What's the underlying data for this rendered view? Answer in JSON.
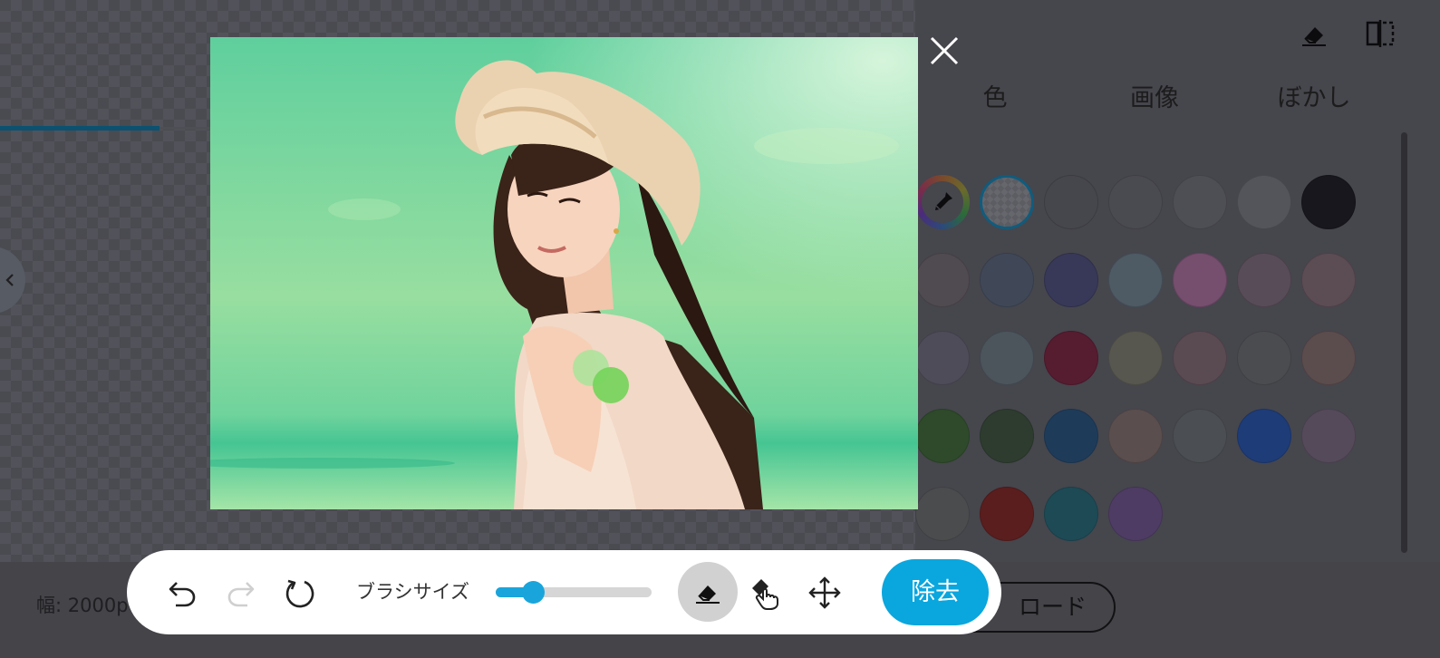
{
  "background_editor": {
    "tabs": [
      {
        "label": "色",
        "active": true
      },
      {
        "label": "画像",
        "active": false
      },
      {
        "label": "ぼかし",
        "active": false
      }
    ],
    "top_icons": [
      "eraser-icon",
      "compare-split-icon"
    ],
    "image_size_text": "幅: 2000p",
    "download_label": "ロード",
    "colors": {
      "accent": "#0c5170",
      "swatches": [
        [
          "eyedropper",
          "transparent",
          "#46464d",
          "#4a4a51",
          "#4e4e55",
          "#53555b",
          "#17171d"
        ],
        [
          "#504b50",
          "#404858",
          "#383858",
          "#4e5a64",
          "#764e6e",
          "#584c58",
          "#5c4c54"
        ],
        [
          "#4e4c58",
          "#4c545c",
          "#561c30",
          "#575750",
          "#5a4a52",
          "#4b4c50",
          "#5b4c4e"
        ],
        [
          "#2e4a2a",
          "#2e3c30",
          "#1e3c5a",
          "#5a4e4e",
          "#4b4e52",
          "#1e3c78",
          "#554a5a"
        ],
        [
          "#4a4c4e",
          "#5a1e1e",
          "#1e4a56",
          "#4e3c64"
        ]
      ]
    }
  },
  "modal": {
    "close_icon": "close-icon"
  },
  "toolbar": {
    "undo_icon": "undo-icon",
    "redo_icon": "redo-icon",
    "reset_icon": "reset-icon",
    "brush_size_label": "ブラシサイズ",
    "brush_size_fraction": 0.24,
    "eraser_icon": "eraser-icon",
    "restore_icon": "restore-brush-icon",
    "move_icon": "move-icon",
    "remove_label": "除去",
    "colors": {
      "accent": "#0aa6de",
      "slider": "#19a5db"
    }
  }
}
